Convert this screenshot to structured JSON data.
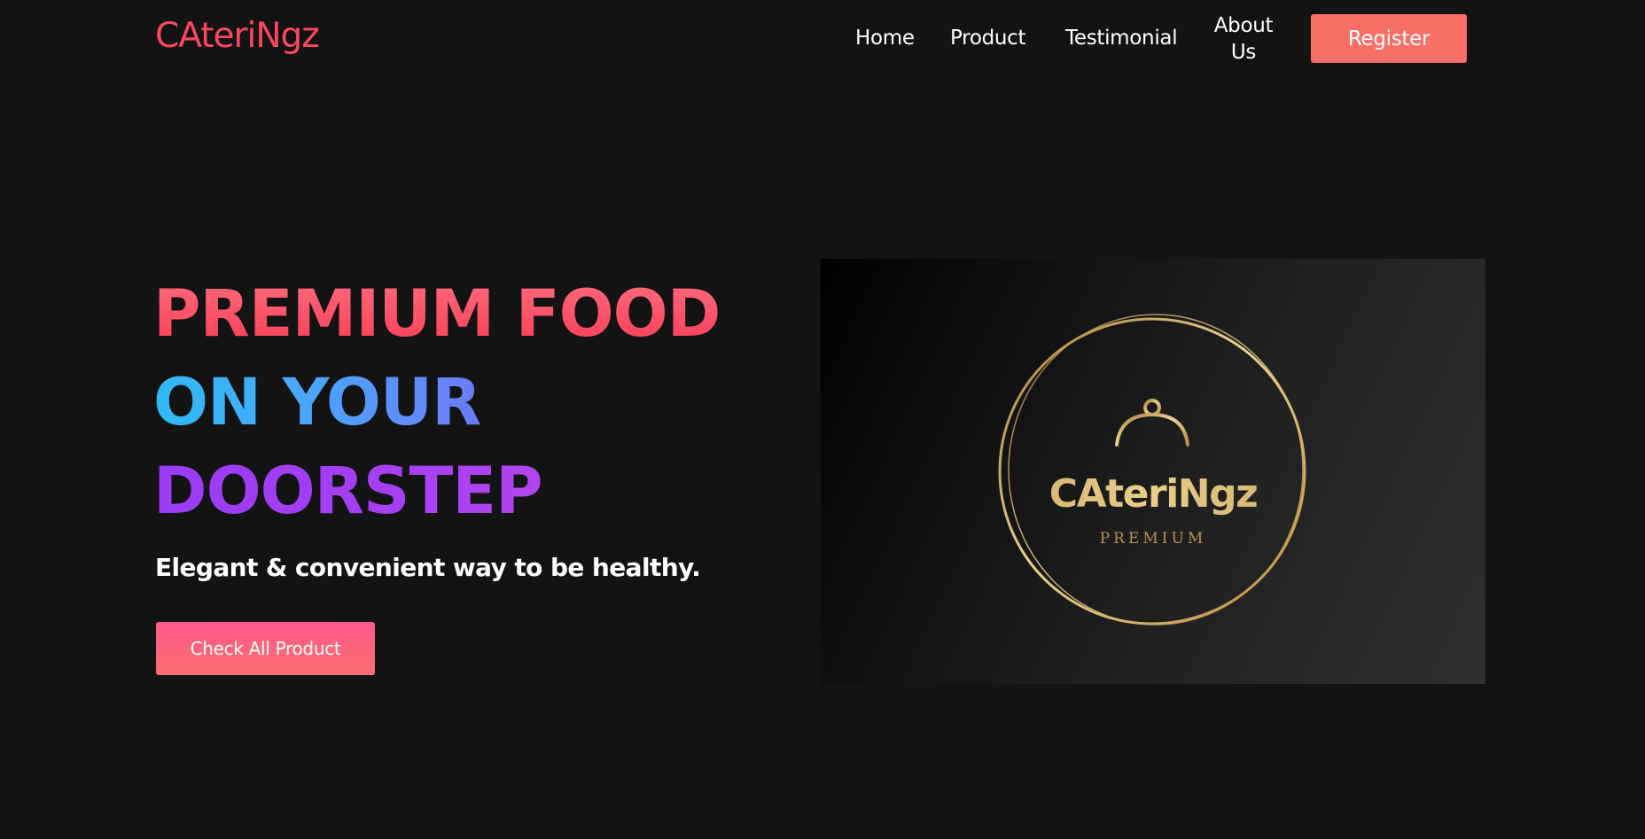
{
  "navbar": {
    "brand": "CAteriNgz",
    "links": {
      "home": "Home",
      "product": "Product",
      "testimonial": "Testimonial",
      "about": "About Us"
    },
    "register_label": "Register"
  },
  "hero": {
    "headline_line1": "PREMIUM FOOD",
    "headline_line2": "ON YOUR",
    "headline_line3": "DOORSTEP",
    "tagline": "Elegant & convenient way to be healthy.",
    "cta_label": "Check All Product"
  },
  "logo_image": {
    "wordmark": "CAteriNgz",
    "subtitle": "PREMIUM",
    "icon": "cloche-icon"
  },
  "colors": {
    "background": "#131313",
    "brand": "#f9485f",
    "register_button": "#f86f66",
    "gold": "#c9a35a"
  }
}
